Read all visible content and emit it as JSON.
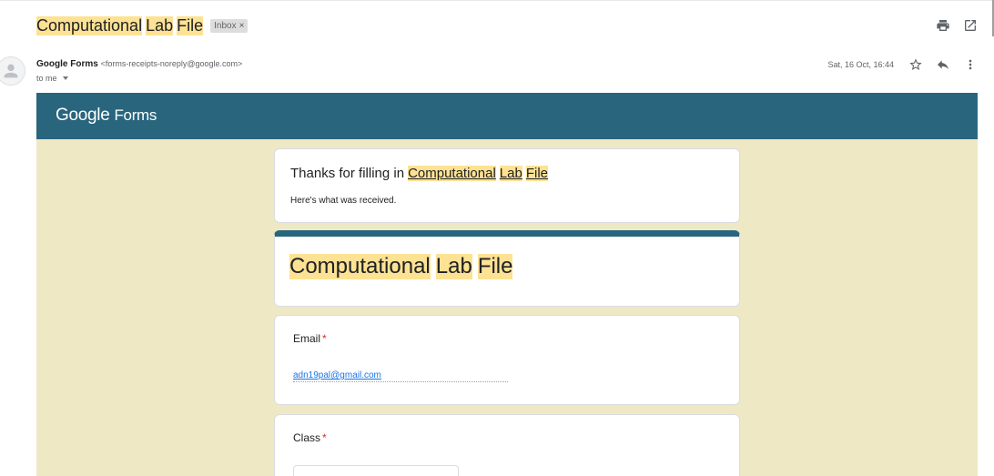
{
  "subject": {
    "words": [
      "Computational",
      "Lab",
      "File"
    ],
    "label_chip": "Inbox",
    "label_close": "×"
  },
  "sender": {
    "name": "Google Forms",
    "email": "<forms-receipts-noreply@google.com>",
    "recipient": "to me",
    "date": "Sat, 16 Oct, 16:44"
  },
  "icons": [
    "print-icon",
    "open-in-new-icon",
    "star-icon",
    "reply-icon",
    "more-vert-icon",
    "avatar-icon",
    "chevron-down-icon"
  ],
  "banner": {
    "brand_google": "Google",
    "brand_forms": "Forms",
    "color": "#29667e"
  },
  "receipt": {
    "thanks_prefix": "Thanks for filling in",
    "form_link_words": [
      "Computational",
      "Lab",
      "File"
    ],
    "received_text": "Here's what was received."
  },
  "form": {
    "title_words": [
      "Computational",
      "Lab",
      "File"
    ]
  },
  "questions": [
    {
      "label": "Email",
      "required_mark": "*",
      "answer": "adn19pal@gmail.com"
    },
    {
      "label": "Class",
      "required_mark": "*",
      "answer": ""
    }
  ],
  "colors": {
    "highlight": "#fde293",
    "body_background": "#efe8c4",
    "accent": "#29667e",
    "required": "#d93025",
    "link": "#1a73e8"
  }
}
